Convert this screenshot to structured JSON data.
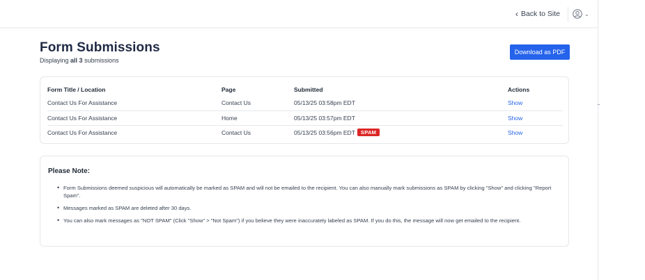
{
  "topbar": {
    "back_label": "Back to Site",
    "user_icon": "user-circle-icon",
    "caret_icon": "chevron-down-icon"
  },
  "page": {
    "title": "Form Submissions",
    "subtitle_prefix": "Displaying",
    "subtitle_count": "all 3",
    "subtitle_suffix": "submissions",
    "download_label": "Download as PDF"
  },
  "table": {
    "headers": [
      "Form Title / Location",
      "Page",
      "Submitted",
      "Actions"
    ],
    "rows": [
      {
        "title": "Contact Us For Assistance",
        "page": "Contact Us",
        "submitted": "05/13/25 03:58pm EDT",
        "action": "Show",
        "spam": ""
      },
      {
        "title": "Contact Us For Assistance",
        "page": "Home",
        "submitted": "05/13/25 03:57pm EDT",
        "action": "Show",
        "spam": ""
      },
      {
        "title": "Contact Us For Assistance",
        "page": "Contact Us",
        "submitted": "05/13/25 03:56pm EDT",
        "action": "Show",
        "spam": "SPAM"
      }
    ]
  },
  "note": {
    "title": "Please Note:",
    "items": [
      "Form Submissions deemed suspicious will automatically be marked as SPAM and will not be emailed to the recipient. You can also manually mark submissions as SPAM by clicking \"Show\" and clicking \"Report Spam\".",
      "Messages marked as SPAM are deleted after 30 days.",
      "You can also mark messages as \"NOT SPAM\" (Click \"Show\" > \"Not Spam\") if you believe they were inaccurately labeled as SPAM. If you do this, the message will now get emailed to the recipient."
    ]
  },
  "colors": {
    "primary": "#2563eb",
    "spam": "#dc2626",
    "title": "#1f2a44"
  }
}
